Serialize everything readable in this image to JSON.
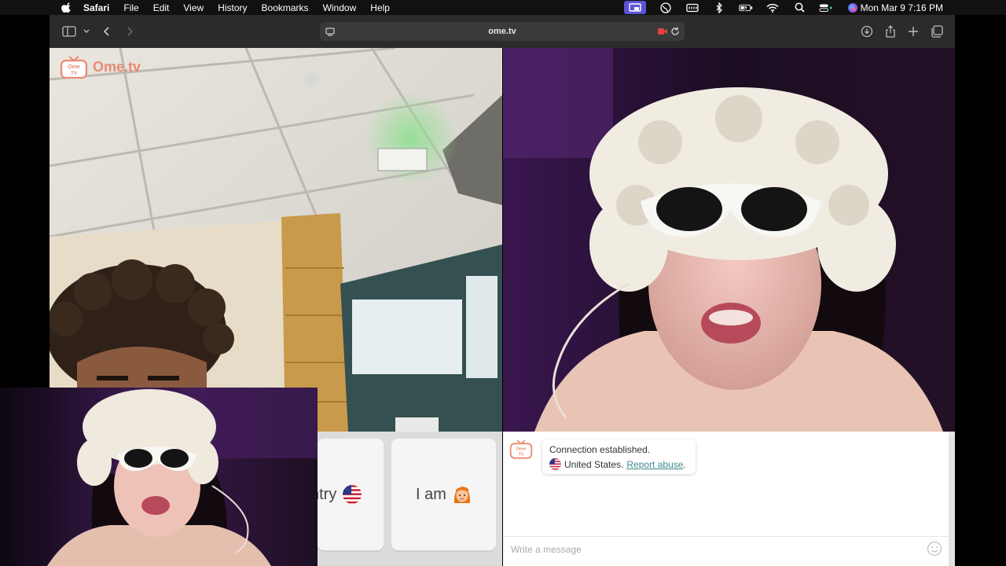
{
  "menubar": {
    "app": "Safari",
    "items": [
      "File",
      "Edit",
      "View",
      "History",
      "Bookmarks",
      "Window",
      "Help"
    ],
    "clock": "Mon Mar 9  7:16 PM"
  },
  "browser": {
    "url": "ome.tv"
  },
  "site": {
    "logo_text": "Ome.tv",
    "logo_badge": "Ome TV"
  },
  "filters": {
    "country_label": "ntry",
    "iam_label": "I am"
  },
  "chat": {
    "status": "Connection established.",
    "country": "United States.",
    "report_label": "Report abuse",
    "report_suffix": ".",
    "input_placeholder": "Write a message"
  },
  "colors": {
    "brand": "#e88a72",
    "link": "#3f8a8c",
    "record": "#e0443a",
    "menubar_active": "#5b54d6"
  }
}
